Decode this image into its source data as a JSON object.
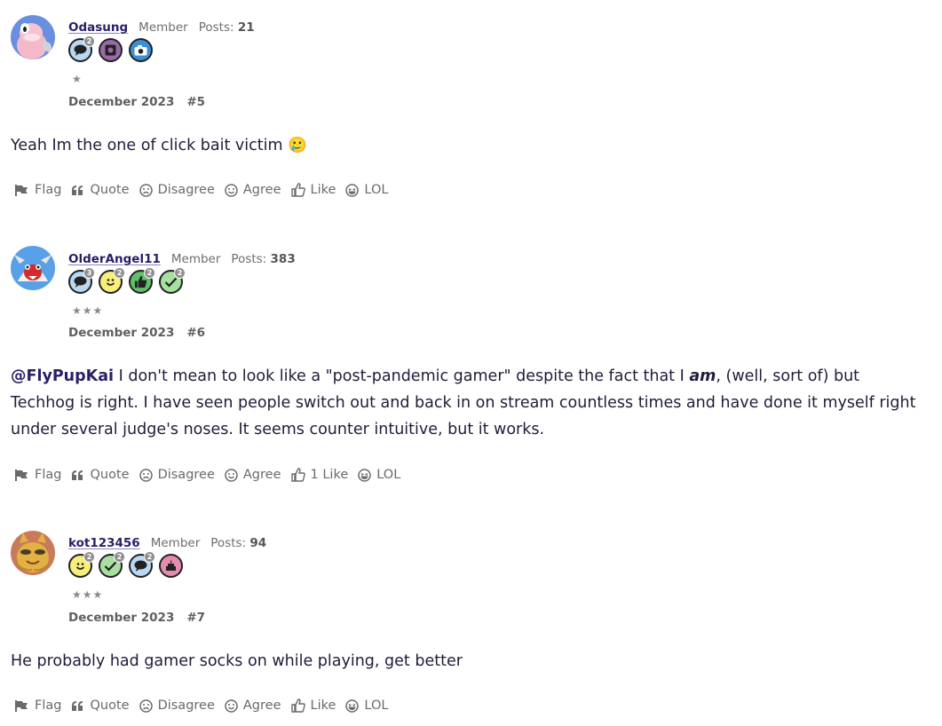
{
  "posts": [
    {
      "username": "Odasung",
      "role": "Member",
      "posts_label": "Posts:",
      "posts_count": "21",
      "stars": "★",
      "date": "December 2023",
      "number": "#5",
      "body": "Yeah Im the one of click bait victim",
      "emoji": "🥲",
      "badges": [
        {
          "icon": "comment-badge-icon",
          "color": "#b9d8f2",
          "level": "2"
        },
        {
          "icon": "photo-badge-icon",
          "color": "#9a6aa8",
          "level": ""
        },
        {
          "icon": "camera-badge-icon",
          "color": "#3c8fd6",
          "level": ""
        }
      ],
      "actions": {
        "flag": "Flag",
        "quote": "Quote",
        "disagree": "Disagree",
        "agree": "Agree",
        "like": "Like",
        "lol": "LOL"
      }
    },
    {
      "username": "OlderAngel11",
      "role": "Member",
      "posts_label": "Posts:",
      "posts_count": "383",
      "stars": "★★★",
      "date": "December 2023",
      "number": "#6",
      "mention": "@FlyPupKai",
      "body_part1": " I don't mean to look like a \"post-pandemic gamer\" despite the fact that I ",
      "body_em": "am",
      "body_part2": ", (well, sort of) but Techhog is right. I have seen people switch out and back in on stream countless times and have done it myself right under several judge's noses. It seems counter intuitive, but it works.",
      "badges": [
        {
          "icon": "comment-badge-icon",
          "color": "#b9d8f2",
          "level": "3"
        },
        {
          "icon": "smile-badge-icon",
          "color": "#f6ef7a",
          "level": "2"
        },
        {
          "icon": "thumbs-up-badge-icon",
          "color": "#5fbf6a",
          "level": "2"
        },
        {
          "icon": "check-badge-icon",
          "color": "#a7e0a0",
          "level": "2"
        }
      ],
      "actions": {
        "flag": "Flag",
        "quote": "Quote",
        "disagree": "Disagree",
        "agree": "Agree",
        "like": "1 Like",
        "lol": "LOL"
      }
    },
    {
      "username": "kot123456",
      "role": "Member",
      "posts_label": "Posts:",
      "posts_count": "94",
      "stars": "★★★",
      "date": "December 2023",
      "number": "#7",
      "body": "He probably had gamer socks on while playing, get better",
      "badges": [
        {
          "icon": "smile-badge-icon",
          "color": "#f6ef7a",
          "level": "2"
        },
        {
          "icon": "check-badge-icon",
          "color": "#a7e0a0",
          "level": "2"
        },
        {
          "icon": "comment-badge-icon",
          "color": "#b9d8f2",
          "level": "2"
        },
        {
          "icon": "cake-badge-icon",
          "color": "#e58bb0",
          "level": ""
        }
      ],
      "actions": {
        "flag": "Flag",
        "quote": "Quote",
        "disagree": "Disagree",
        "agree": "Agree",
        "like": "Like",
        "lol": "LOL"
      }
    }
  ]
}
